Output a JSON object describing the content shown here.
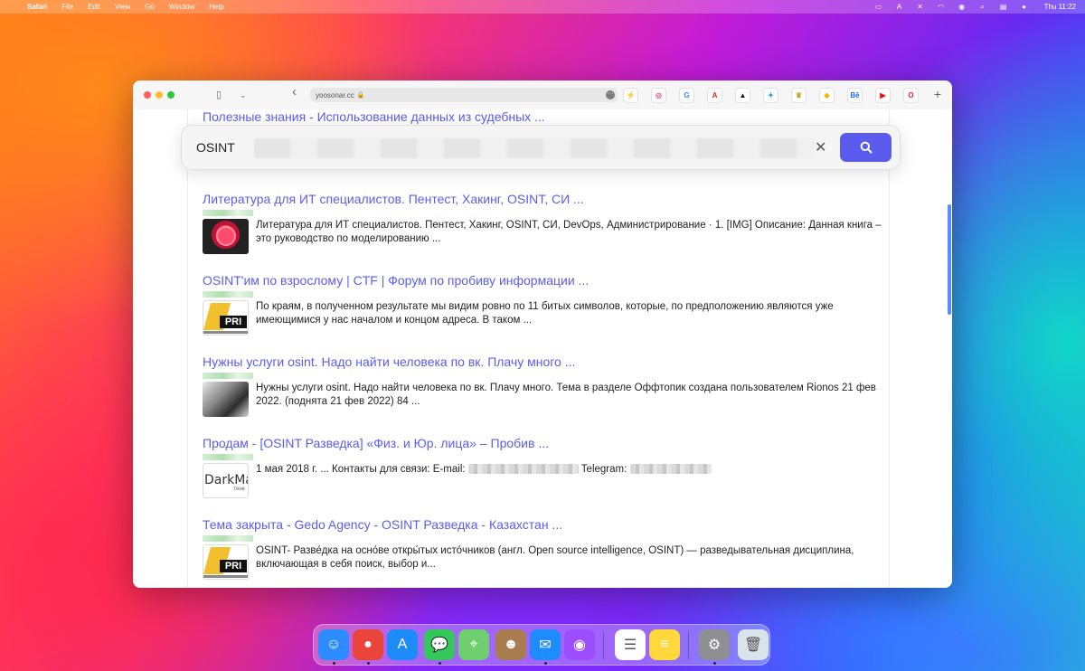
{
  "menubar": {
    "apple_icon": "apple-icon",
    "app_name": "Safari",
    "items": [
      "File",
      "Edit",
      "View",
      "Go",
      "Window",
      "Help"
    ],
    "time": "Thu 11:22"
  },
  "browser": {
    "address": "yoosonar.cc",
    "more_glyph": "···",
    "back_glyph": "‹",
    "new_tab_glyph": "+",
    "favorites": [
      {
        "name": "bolt-icon",
        "glyph": "⚡",
        "color": "#f7b500"
      },
      {
        "name": "dribbble-icon",
        "glyph": "◎",
        "color": "#ea4c89"
      },
      {
        "name": "google-icon",
        "glyph": "G",
        "color": "#4285f4"
      },
      {
        "name": "adobe-icon",
        "glyph": "A",
        "color": "#e1251b"
      },
      {
        "name": "adidas-icon",
        "glyph": "▲",
        "color": "#111111"
      },
      {
        "name": "twitter-icon",
        "glyph": "✦",
        "color": "#1d9bf0"
      },
      {
        "name": "crown-icon",
        "glyph": "♛",
        "color": "#c9a227"
      },
      {
        "name": "sketch-icon",
        "glyph": "◆",
        "color": "#f7b500"
      },
      {
        "name": "behance-icon",
        "glyph": "Bē",
        "color": "#1769ff"
      },
      {
        "name": "youtube-icon",
        "glyph": "▶",
        "color": "#ff0000"
      },
      {
        "name": "opera-icon",
        "glyph": "O",
        "color": "#ff1b2d"
      }
    ]
  },
  "search": {
    "query": "OSINT",
    "clear_glyph": "✕"
  },
  "results": [
    {
      "title": "Полезные знания - Использование данных из судебных ...",
      "snippet": ""
    },
    {
      "title": "Литература для ИТ специалистов. Пентест, Хакинг, OSINT, СИ ...",
      "snippet": "Литература для ИТ специалистов. Пентест, Хакинг, OSINT, СИ, DevOps, Администрирование · 1. [IMG] Описание: Данная книга – это руководство по моделированию ..."
    },
    {
      "title": "OSINT'им по взрослому | CTF | Форум по пробиву информации ...",
      "snippet": "По краям, в полученном результате мы видим ровно по 11 битых символов, которые, по предположению являются уже имеющимися у нас началом и концом адреса. В таком ..."
    },
    {
      "title": "Нужны услуги osint. Надо найти человека по вк. Плачу много ...",
      "snippet": "Нужны услуги osint. Надо найти человека по вк. Плачу много. Тема в разделе Оффтопик создана пользователем Rionos 21 фев 2022. (поднята 21 фев 2022) 84 ..."
    },
    {
      "title": "Продам - [OSINT Разведка] «Физ. и Юр. лица» – Пробив ...",
      "snippet_a": "1 мая 2018 г. ... Контакты для связи: E-mail:",
      "snippet_b": "Telegram:",
      "thumb_text": "DarkMa",
      "thumb_sub": "тене"
    },
    {
      "title": "Тема закрыта - Gedo Agency - OSINT Разведка - Казахстан ...",
      "snippet": "OSINT- Разве́дка на осно́ве откры́тых исто́чников (англ. Open source intelligence, OSINT) — разведывательная дисциплина, включающая в себя поиск, выбор и..."
    }
  ],
  "osint_thumb_text": "PRI",
  "dock": [
    {
      "name": "finder-icon",
      "color": "#2d8cff",
      "glyph": "☺",
      "dot": true
    },
    {
      "name": "chrome-icon",
      "color": "#e9453b",
      "glyph": "●",
      "dot": true
    },
    {
      "name": "app-store-icon",
      "color": "#1d8cf8",
      "glyph": "A",
      "dot": false
    },
    {
      "name": "messages-icon",
      "color": "#34c759",
      "glyph": "💬",
      "dot": true
    },
    {
      "name": "maps-icon",
      "color": "#6fcf6f",
      "glyph": "⌖",
      "dot": false
    },
    {
      "name": "contacts-icon",
      "color": "#a97c50",
      "glyph": "☻",
      "dot": false
    },
    {
      "name": "mail-icon",
      "color": "#1e8bff",
      "glyph": "✉",
      "dot": true
    },
    {
      "name": "podcasts-icon",
      "color": "#9b4dff",
      "glyph": "◉",
      "dot": false
    },
    {
      "name": "reminders-icon",
      "color": "#ffffff",
      "glyph": "☰",
      "dot": false
    },
    {
      "name": "notes-icon",
      "color": "#ffd83b",
      "glyph": "≡",
      "dot": false
    },
    {
      "name": "system-preferences-icon",
      "color": "#8e8e93",
      "glyph": "⚙",
      "dot": true
    },
    {
      "name": "trash-icon",
      "color": "#d9e3ea",
      "glyph": "🗑",
      "dot": false
    }
  ]
}
